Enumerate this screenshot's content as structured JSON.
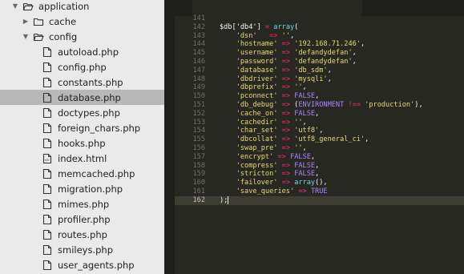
{
  "sidebar": {
    "items": [
      {
        "label": "application",
        "indent": 0,
        "kind": "folder-open",
        "twisty": "▼"
      },
      {
        "label": "cache",
        "indent": 1,
        "kind": "folder",
        "twisty": "▶"
      },
      {
        "label": "config",
        "indent": 1,
        "kind": "folder-open",
        "twisty": "▼"
      },
      {
        "label": "autoload.php",
        "indent": 2,
        "kind": "file"
      },
      {
        "label": "config.php",
        "indent": 2,
        "kind": "file"
      },
      {
        "label": "constants.php",
        "indent": 2,
        "kind": "file"
      },
      {
        "label": "database.php",
        "indent": 2,
        "kind": "file",
        "selected": true
      },
      {
        "label": "doctypes.php",
        "indent": 2,
        "kind": "file"
      },
      {
        "label": "foreign_chars.php",
        "indent": 2,
        "kind": "file"
      },
      {
        "label": "hooks.php",
        "indent": 2,
        "kind": "file"
      },
      {
        "label": "index.html",
        "indent": 2,
        "kind": "file-html"
      },
      {
        "label": "memcached.php",
        "indent": 2,
        "kind": "file"
      },
      {
        "label": "migration.php",
        "indent": 2,
        "kind": "file"
      },
      {
        "label": "mimes.php",
        "indent": 2,
        "kind": "file"
      },
      {
        "label": "profiler.php",
        "indent": 2,
        "kind": "file"
      },
      {
        "label": "routes.php",
        "indent": 2,
        "kind": "file"
      },
      {
        "label": "smileys.php",
        "indent": 2,
        "kind": "file"
      },
      {
        "label": "user_agents.php",
        "indent": 2,
        "kind": "file"
      }
    ]
  },
  "editor": {
    "current_line": "162",
    "lines": [
      {
        "n": "141",
        "tokens": []
      },
      {
        "n": "142",
        "tokens": [
          [
            "var",
            "$db['db4'] "
          ],
          [
            "op",
            "="
          ],
          [
            "pl",
            " "
          ],
          [
            "fn",
            "array"
          ],
          [
            "pl",
            "("
          ]
        ]
      },
      {
        "n": "143",
        "tokens": [
          [
            "pl",
            "    "
          ],
          [
            "str",
            "'dsn'"
          ],
          [
            "pl",
            "   "
          ],
          [
            "op",
            "=>"
          ],
          [
            "pl",
            " "
          ],
          [
            "str",
            "''"
          ],
          [
            "pl",
            ","
          ]
        ]
      },
      {
        "n": "144",
        "tokens": [
          [
            "pl",
            "    "
          ],
          [
            "str",
            "'hostname'"
          ],
          [
            "pl",
            " "
          ],
          [
            "op",
            "=>"
          ],
          [
            "pl",
            " "
          ],
          [
            "str",
            "'192.168.71.246'"
          ],
          [
            "pl",
            ","
          ]
        ]
      },
      {
        "n": "145",
        "tokens": [
          [
            "pl",
            "    "
          ],
          [
            "str",
            "'username'"
          ],
          [
            "pl",
            " "
          ],
          [
            "op",
            "=>"
          ],
          [
            "pl",
            " "
          ],
          [
            "str",
            "'defandydefan'"
          ],
          [
            "pl",
            ","
          ]
        ]
      },
      {
        "n": "146",
        "tokens": [
          [
            "pl",
            "    "
          ],
          [
            "str",
            "'password'"
          ],
          [
            "pl",
            " "
          ],
          [
            "op",
            "=>"
          ],
          [
            "pl",
            " "
          ],
          [
            "str",
            "'defandydefan'"
          ],
          [
            "pl",
            ","
          ]
        ]
      },
      {
        "n": "147",
        "tokens": [
          [
            "pl",
            "    "
          ],
          [
            "str",
            "'database'"
          ],
          [
            "pl",
            " "
          ],
          [
            "op",
            "=>"
          ],
          [
            "pl",
            " "
          ],
          [
            "str",
            "'db_sdm'"
          ],
          [
            "pl",
            ","
          ]
        ]
      },
      {
        "n": "148",
        "tokens": [
          [
            "pl",
            "    "
          ],
          [
            "str",
            "'dbdriver'"
          ],
          [
            "pl",
            " "
          ],
          [
            "op",
            "=>"
          ],
          [
            "pl",
            " "
          ],
          [
            "str",
            "'mysqli'"
          ],
          [
            "pl",
            ","
          ]
        ]
      },
      {
        "n": "149",
        "tokens": [
          [
            "pl",
            "    "
          ],
          [
            "str",
            "'dbprefix'"
          ],
          [
            "pl",
            " "
          ],
          [
            "op",
            "=>"
          ],
          [
            "pl",
            " "
          ],
          [
            "str",
            "''"
          ],
          [
            "pl",
            ","
          ]
        ]
      },
      {
        "n": "150",
        "tokens": [
          [
            "pl",
            "    "
          ],
          [
            "str",
            "'pconnect'"
          ],
          [
            "pl",
            " "
          ],
          [
            "op",
            "=>"
          ],
          [
            "pl",
            " "
          ],
          [
            "const",
            "FALSE"
          ],
          [
            "pl",
            ","
          ]
        ]
      },
      {
        "n": "151",
        "tokens": [
          [
            "pl",
            "    "
          ],
          [
            "str",
            "'db_debug'"
          ],
          [
            "pl",
            " "
          ],
          [
            "op",
            "=>"
          ],
          [
            "pl",
            " ("
          ],
          [
            "const",
            "ENVIRONMENT"
          ],
          [
            "pl",
            " "
          ],
          [
            "op",
            "!=="
          ],
          [
            "pl",
            " "
          ],
          [
            "str",
            "'production'"
          ],
          [
            "pl",
            "),"
          ]
        ]
      },
      {
        "n": "152",
        "tokens": [
          [
            "pl",
            "    "
          ],
          [
            "str",
            "'cache_on'"
          ],
          [
            "pl",
            " "
          ],
          [
            "op",
            "=>"
          ],
          [
            "pl",
            " "
          ],
          [
            "const",
            "FALSE"
          ],
          [
            "pl",
            ","
          ]
        ]
      },
      {
        "n": "153",
        "tokens": [
          [
            "pl",
            "    "
          ],
          [
            "str",
            "'cachedir'"
          ],
          [
            "pl",
            " "
          ],
          [
            "op",
            "=>"
          ],
          [
            "pl",
            " "
          ],
          [
            "str",
            "''"
          ],
          [
            "pl",
            ","
          ]
        ]
      },
      {
        "n": "154",
        "tokens": [
          [
            "pl",
            "    "
          ],
          [
            "str",
            "'char_set'"
          ],
          [
            "pl",
            " "
          ],
          [
            "op",
            "=>"
          ],
          [
            "pl",
            " "
          ],
          [
            "str",
            "'utf8'"
          ],
          [
            "pl",
            ","
          ]
        ]
      },
      {
        "n": "155",
        "tokens": [
          [
            "pl",
            "    "
          ],
          [
            "str",
            "'dbcollat'"
          ],
          [
            "pl",
            " "
          ],
          [
            "op",
            "=>"
          ],
          [
            "pl",
            " "
          ],
          [
            "str",
            "'utf8_general_ci'"
          ],
          [
            "pl",
            ","
          ]
        ]
      },
      {
        "n": "156",
        "tokens": [
          [
            "pl",
            "    "
          ],
          [
            "str",
            "'swap_pre'"
          ],
          [
            "pl",
            " "
          ],
          [
            "op",
            "=>"
          ],
          [
            "pl",
            " "
          ],
          [
            "str",
            "''"
          ],
          [
            "pl",
            ","
          ]
        ]
      },
      {
        "n": "157",
        "tokens": [
          [
            "pl",
            "    "
          ],
          [
            "str",
            "'encrypt'"
          ],
          [
            "pl",
            " "
          ],
          [
            "op",
            "=>"
          ],
          [
            "pl",
            " "
          ],
          [
            "const",
            "FALSE"
          ],
          [
            "pl",
            ","
          ]
        ]
      },
      {
        "n": "158",
        "tokens": [
          [
            "pl",
            "    "
          ],
          [
            "str",
            "'compress'"
          ],
          [
            "pl",
            " "
          ],
          [
            "op",
            "=>"
          ],
          [
            "pl",
            " "
          ],
          [
            "const",
            "FALSE"
          ],
          [
            "pl",
            ","
          ]
        ]
      },
      {
        "n": "159",
        "tokens": [
          [
            "pl",
            "    "
          ],
          [
            "str",
            "'stricton'"
          ],
          [
            "pl",
            " "
          ],
          [
            "op",
            "=>"
          ],
          [
            "pl",
            " "
          ],
          [
            "const",
            "FALSE"
          ],
          [
            "pl",
            ","
          ]
        ]
      },
      {
        "n": "160",
        "tokens": [
          [
            "pl",
            "    "
          ],
          [
            "str",
            "'failover'"
          ],
          [
            "pl",
            " "
          ],
          [
            "op",
            "=>"
          ],
          [
            "pl",
            " "
          ],
          [
            "fn",
            "array"
          ],
          [
            "pl",
            "(),"
          ]
        ]
      },
      {
        "n": "161",
        "tokens": [
          [
            "pl",
            "    "
          ],
          [
            "str",
            "'save_queries'"
          ],
          [
            "pl",
            " "
          ],
          [
            "op",
            "=>"
          ],
          [
            "pl",
            " "
          ],
          [
            "const",
            "TRUE"
          ]
        ]
      },
      {
        "n": "162",
        "tokens": [
          [
            "pl",
            ");"
          ]
        ],
        "cursor": true
      }
    ]
  },
  "colors": {
    "sidebar_bg": "#eaeaea",
    "sidebar_selected": "#b8b8b8",
    "editor_bg": "#272822",
    "string": "#e6db74",
    "operator": "#f92672",
    "function": "#66d9ef",
    "constant": "#ae81ff",
    "line_number": "#75715e"
  }
}
